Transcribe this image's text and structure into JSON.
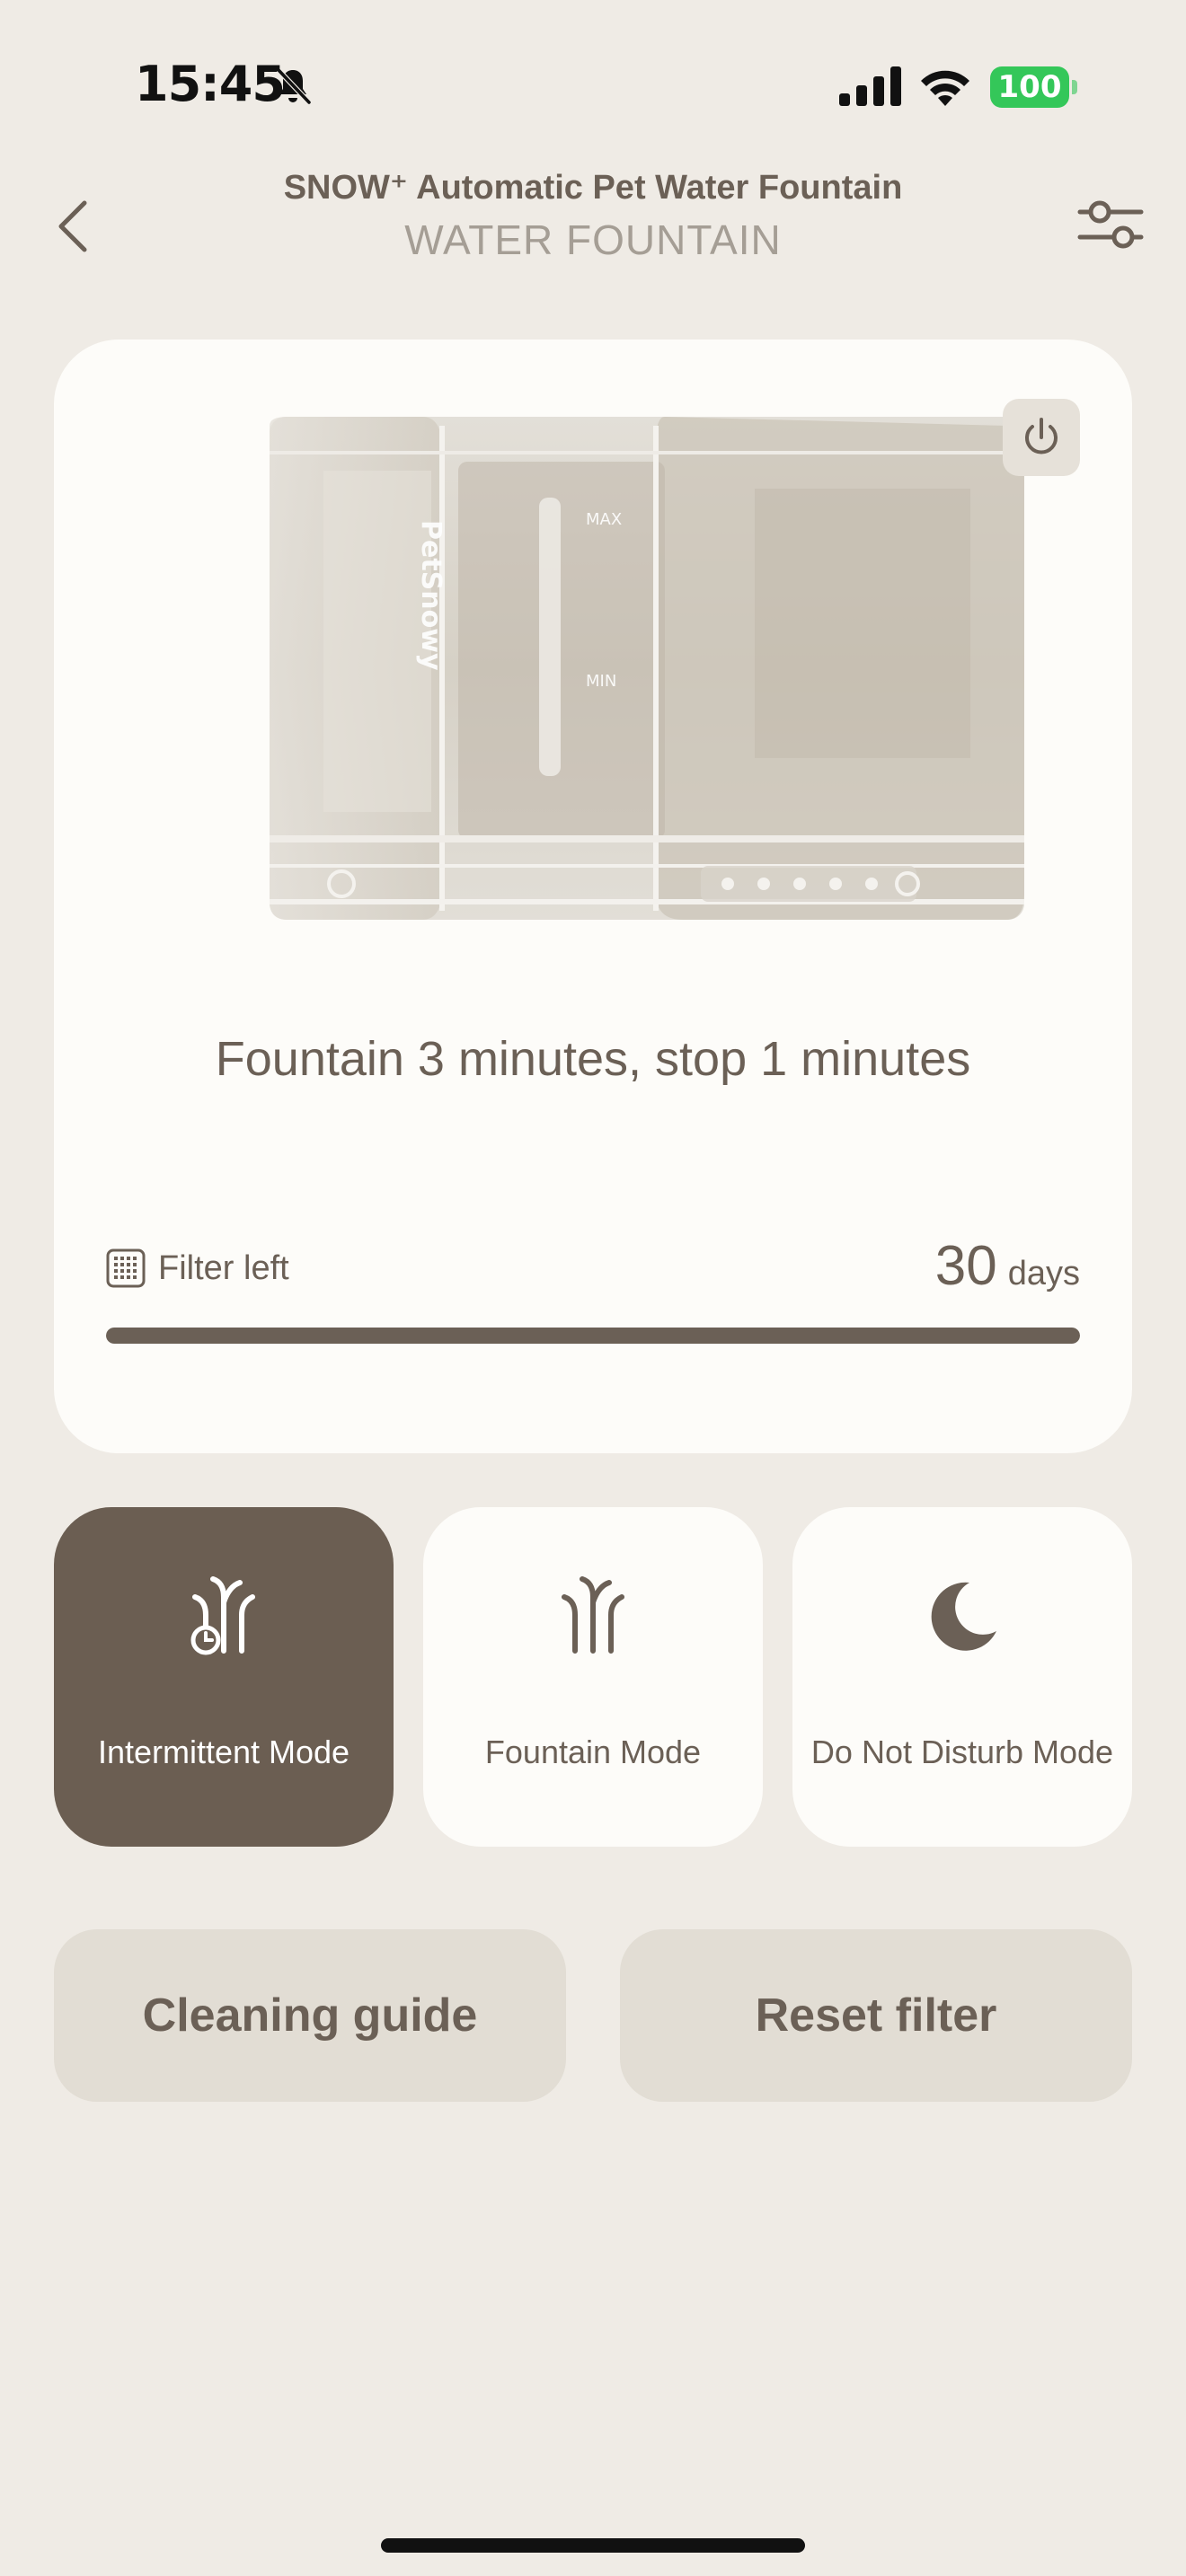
{
  "status_bar": {
    "time": "15:45",
    "battery": "100",
    "icons": [
      "bell-slash-icon",
      "cellular-signal-icon",
      "wifi-icon",
      "battery-icon"
    ]
  },
  "header": {
    "title": "SNOW⁺ Automatic Pet Water Fountain",
    "subtitle": "WATER FOUNTAIN",
    "back_icon": "chevron-left-icon",
    "settings_icon": "sliders-icon"
  },
  "device_card": {
    "power_icon": "power-icon",
    "device_marks": {
      "max": "MAX",
      "min": "MIN",
      "brand": "PetSnowy"
    },
    "schedule": "Fountain 3 minutes, stop 1 minutes",
    "filter": {
      "label": "Filter left",
      "days": "30",
      "unit": "days",
      "progress_fraction": 1.0
    }
  },
  "modes": [
    {
      "label": "Intermittent Mode",
      "icon": "intermittent-fountain-icon",
      "active": true
    },
    {
      "label": "Fountain Mode",
      "icon": "fountain-icon",
      "active": false
    },
    {
      "label": "Do Not Disturb Mode",
      "icon": "moon-icon",
      "active": false
    }
  ],
  "actions": {
    "cleaning_guide": "Cleaning guide",
    "reset_filter": "Reset filter"
  },
  "colors": {
    "accent": "#6b5e52",
    "background": "#efebe5",
    "card": "#fdfcf9",
    "battery": "#34c759"
  }
}
